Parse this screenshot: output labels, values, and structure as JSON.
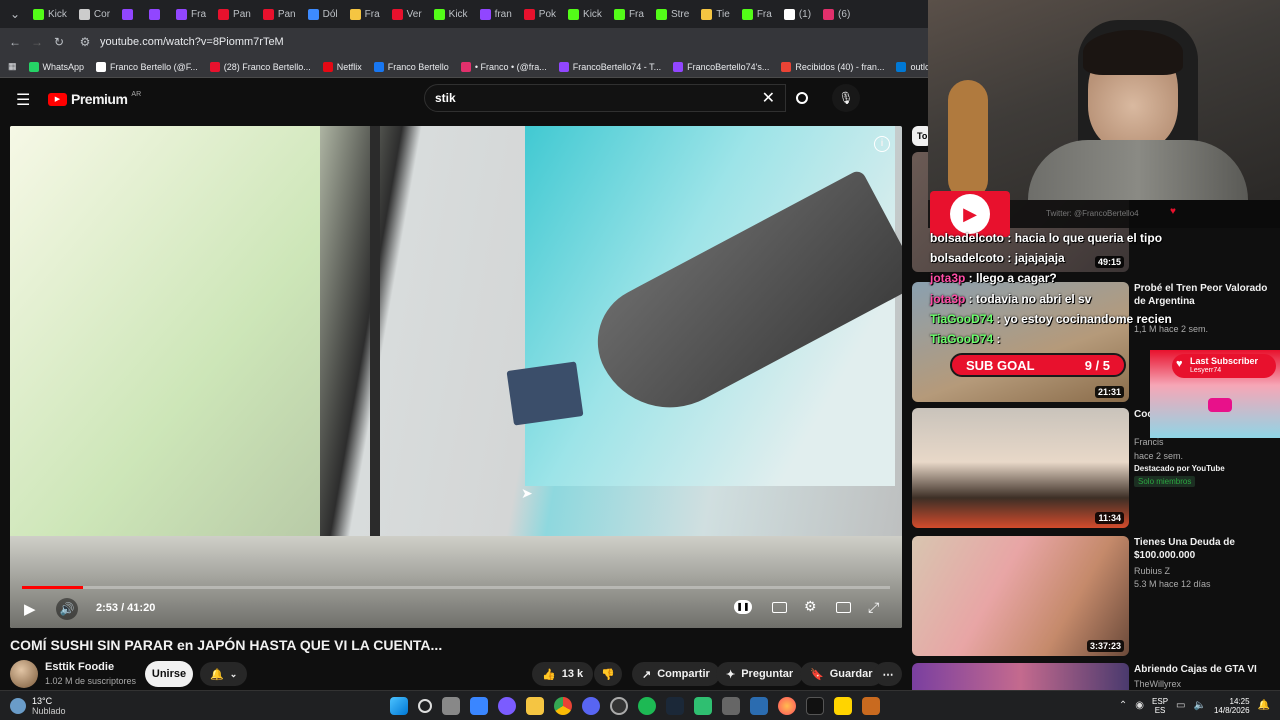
{
  "browser": {
    "tabs": [
      "Kick",
      "Cor",
      "",
      "",
      "Fra",
      "Pan",
      "Pan",
      "Dól",
      "Fra",
      "Ver",
      "Kick",
      "fran",
      "Pok",
      "Kick",
      "Fra",
      "Stre",
      "Tie",
      "Fra",
      "(1)",
      "(6)"
    ],
    "url": "youtube.com/watch?v=8Piomm7rTeM",
    "bookmarks": [
      "WhatsApp",
      "Franco Bertello (@F...",
      "(28) Franco Bertello...",
      "Netflix",
      "Franco Bertello",
      "• Franco • (@fra...",
      "FrancoBertello74 - T...",
      "FrancoBertello74's...",
      "Recibidos (40) - fran...",
      "outlook",
      "Alert"
    ]
  },
  "youtube": {
    "logo_text": "Premium",
    "country": "AR",
    "search_value": "stik",
    "player": {
      "time": "2:53 / 41:20",
      "progress": 0.07
    },
    "video": {
      "title": "COMÍ SUSHI SIN PARAR en JAPÓN HASTA QUE VI LA CUENTA...",
      "channel": "Esttik Foodie",
      "subscribers": "1.02 M de suscriptores",
      "join_label": "Unirse",
      "likes": "13 k",
      "share_label": "Compartir",
      "ask_label": "Preguntar",
      "save_label": "Guardar"
    },
    "sidebar_chip": "To",
    "recommendations": [
      {
        "title": "",
        "channel": "",
        "meta": "",
        "duration": "49:15"
      },
      {
        "title": "Probé el Tren Peor Valorado de Argentina",
        "channel": "",
        "meta": "1,1 M  hace 2 sem.",
        "duration": "21:31"
      },
      {
        "title": "Coc... por...",
        "channel": "Francis",
        "meta": "hace 2 sem.",
        "extra": "Destacado por YouTube",
        "badge": "Solo miembros",
        "duration": "11:34"
      },
      {
        "title": "Tienes Una Deuda de $100.000.000",
        "channel": "Rubius Z",
        "meta": "5.3 M  hace 12 días",
        "duration": "3:37:23"
      },
      {
        "title": "Abriendo Cajas de GTA VI",
        "channel": "TheWillyrex",
        "meta": "",
        "duration": ""
      }
    ]
  },
  "stream_overlay": {
    "twitter": "Twitter: @FrancoBertello4",
    "chat": [
      {
        "user": "bolsadelcoto",
        "msg": "hacia lo que queria el tipo"
      },
      {
        "user": "bolsadelcoto",
        "msg": "jajajajaja"
      },
      {
        "user": "jota3p",
        "msg": "llego a cagar?"
      },
      {
        "user": "jota3p",
        "msg": "todavia no abri el sv"
      },
      {
        "user": "TiaGooD74",
        "msg": "yo estoy cocinandome recien"
      },
      {
        "user": "TiaGooD74",
        "msg": ""
      }
    ],
    "sub_goal_label": "SUB GOAL",
    "sub_goal_value": "9 / 5",
    "last_sub_label": "Last Subscriber",
    "last_sub_name": "Lesyerr74"
  },
  "taskbar": {
    "temp": "13°C",
    "weather": "Nublado",
    "lang1": "ESP",
    "lang2": "ES",
    "time": "14:25",
    "date": "14/8/2026"
  },
  "colors": {
    "yt_red": "#ff0000",
    "accent_red": "#e8112d"
  }
}
